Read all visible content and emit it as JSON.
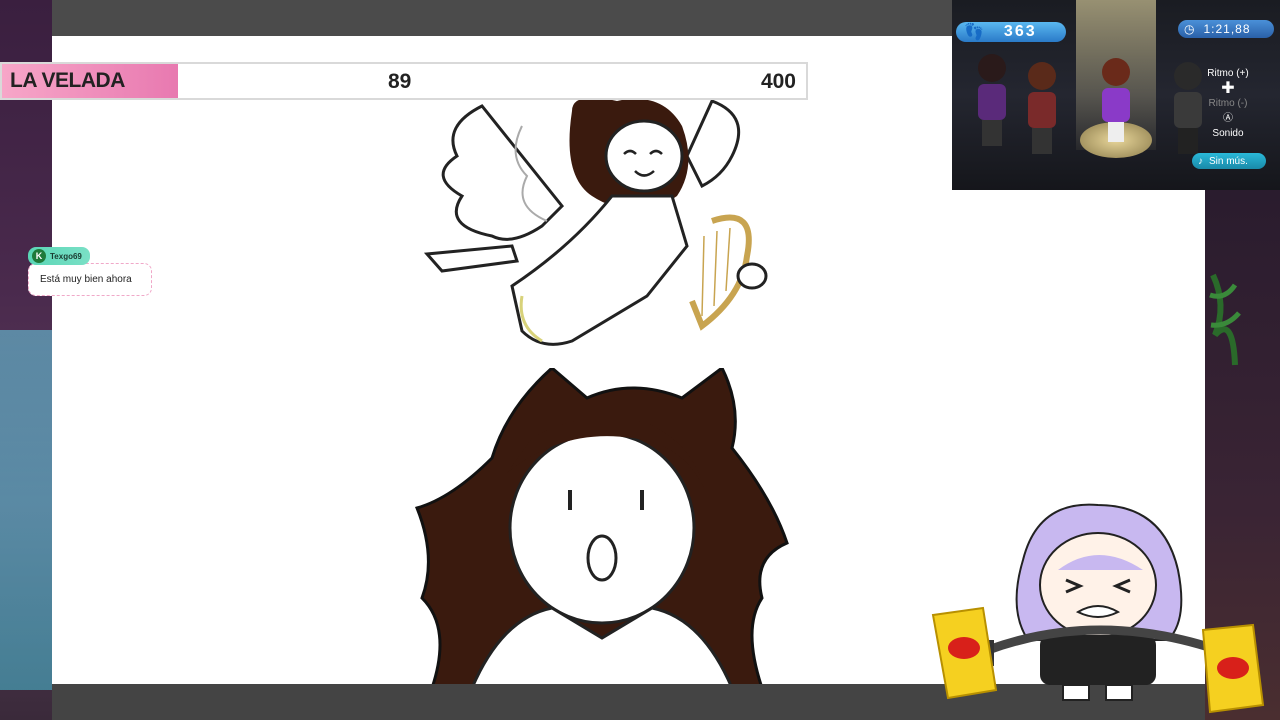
{
  "stream": {
    "progress_label": "LA VELADA",
    "progress_current": "89",
    "progress_goal": "400",
    "progress_fraction": 0.2225
  },
  "chat": {
    "username": "Texgo69",
    "message": "Está muy bien ahora"
  },
  "game_overlay": {
    "score": "363",
    "timer": "1:21,88",
    "control_tempo_up": "Ritmo (+)",
    "control_tempo_down": "Ritmo (-)",
    "control_sound": "Sonido",
    "mute_label": "Sin mús."
  },
  "colors": {
    "progress_label_bg": "#e879b0",
    "chat_user_bg": "#5ad6b6",
    "game_badge": "#2a7ac8",
    "hair": "#3a1a0e"
  },
  "icons": {
    "score": "footprint-icon",
    "timer": "clock-icon",
    "tempo": "dpad-icon",
    "sound": "a-button-icon",
    "mute": "music-note-icon",
    "chat_badge": "k-badge-icon"
  }
}
